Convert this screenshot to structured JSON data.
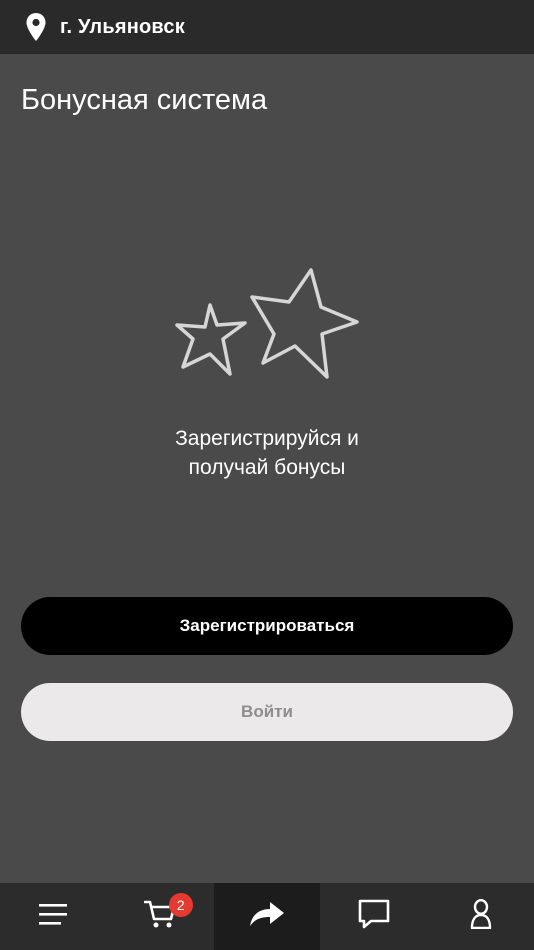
{
  "header": {
    "city": "г. Ульяновск",
    "location_icon": "location-pin-icon"
  },
  "page": {
    "title": "Бонусная система"
  },
  "promo": {
    "icon": "stars-icon",
    "line1": "Зарегистрируйся и",
    "line2": "получай бонусы"
  },
  "actions": {
    "register_label": "Зарегистрироваться",
    "login_label": "Войти"
  },
  "tabbar": {
    "cart_badge": "2",
    "items": [
      "menu-icon",
      "cart-icon",
      "share-icon",
      "chat-icon",
      "profile-icon"
    ]
  },
  "colors": {
    "background": "#4a4a4a",
    "topbar": "#2a2a2a",
    "tabbar": "#2c2c2c",
    "tab_active": "#1c1c1c",
    "primary_button": "#000000",
    "secondary_button": "#ebe9ea",
    "badge": "#e53a2f"
  }
}
